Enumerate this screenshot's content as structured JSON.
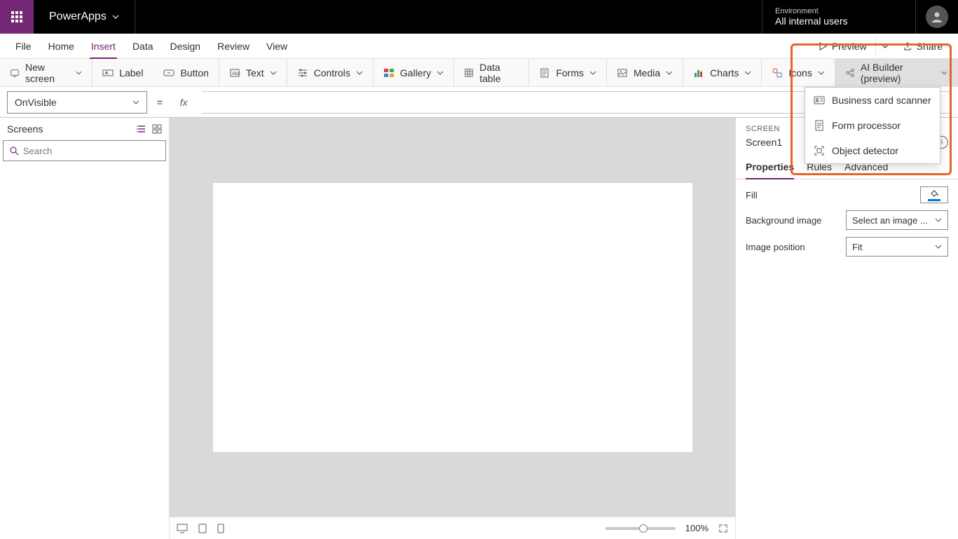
{
  "header": {
    "app_name": "PowerApps",
    "env_label": "Environment",
    "env_value": "All internal users"
  },
  "menu": {
    "tabs": [
      "File",
      "Home",
      "Insert",
      "Data",
      "Design",
      "Review",
      "View"
    ],
    "active": "Insert",
    "preview_label": "Preview",
    "share_label": "Share"
  },
  "ribbon": {
    "new_screen": "New screen",
    "label": "Label",
    "button": "Button",
    "text": "Text",
    "controls": "Controls",
    "gallery": "Gallery",
    "data_table": "Data table",
    "forms": "Forms",
    "media": "Media",
    "charts": "Charts",
    "icons": "Icons",
    "ai_builder": "AI Builder (preview)"
  },
  "formula": {
    "property": "OnVisible",
    "equals": "=",
    "fx": "fx",
    "value": ""
  },
  "left_panel": {
    "title": "Screens",
    "search_placeholder": "Search"
  },
  "canvas": {
    "zoom": "100%"
  },
  "right_panel": {
    "section_label": "SCREEN",
    "screen_name": "Screen1",
    "tabs": [
      "Properties",
      "Rules",
      "Advanced"
    ],
    "active_tab": "Properties",
    "fill_label": "Fill",
    "bg_image_label": "Background image",
    "bg_image_value": "Select an image ...",
    "img_pos_label": "Image position",
    "img_pos_value": "Fit"
  },
  "ai_menu": {
    "items": [
      {
        "label": "Business card scanner"
      },
      {
        "label": "Form processor"
      },
      {
        "label": "Object detector"
      }
    ]
  }
}
